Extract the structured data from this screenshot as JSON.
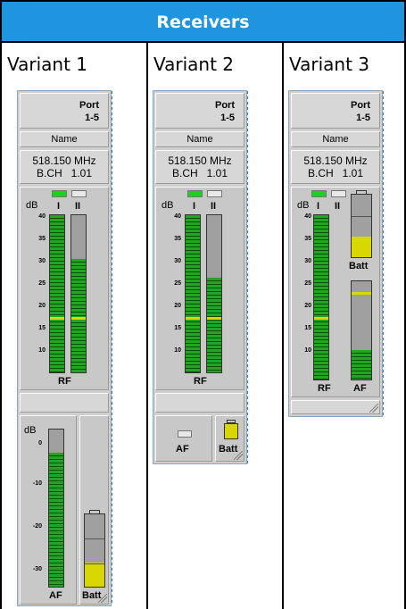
{
  "header": {
    "title": "Receivers"
  },
  "columns": [
    {
      "label": "Variant 1"
    },
    {
      "label": "Variant 2"
    },
    {
      "label": "Variant 3"
    }
  ],
  "panel": {
    "port_label": "Port",
    "port_range": "1-5",
    "name": "Name",
    "frequency": "518.150 MHz",
    "channel": "B.CH   1.01",
    "rf_label": "RF",
    "af_label": "AF",
    "batt_label": "Batt",
    "db_label": "dB",
    "ch1": "I",
    "ch2": "II",
    "rf_ticks": [
      "40",
      "35",
      "30",
      "25",
      "20",
      "15",
      "10"
    ],
    "af_ticks": [
      "0",
      "-10",
      "-20",
      "-30"
    ]
  },
  "levels": {
    "rf_ch1": 1.0,
    "rf_ch2_v1": 0.72,
    "rf_ch2_v2": 0.6,
    "rf_ch2_v3": 1.0,
    "af_v1": 0.85,
    "af_v3": 0.3,
    "batt_v1": 0.33,
    "batt_v3": 0.33
  },
  "colors": {
    "header_bg": "#1f95e0",
    "meter_green": "#22a622",
    "batt_yellow": "#d8d800"
  }
}
